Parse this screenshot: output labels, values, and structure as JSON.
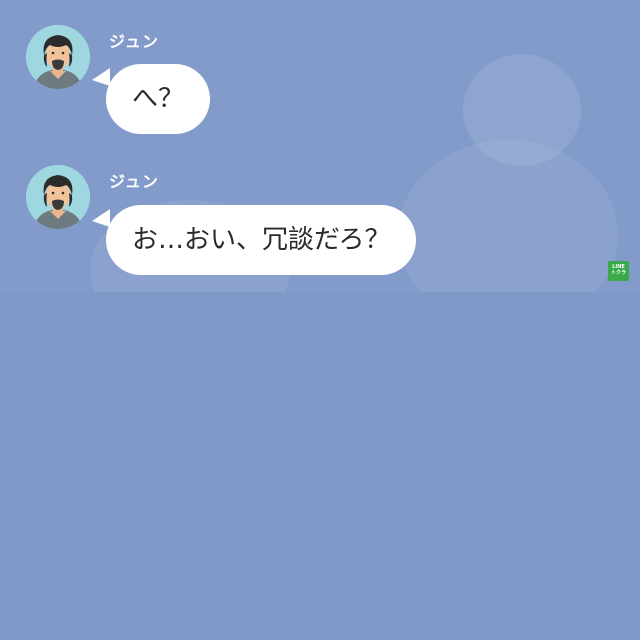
{
  "colors": {
    "chat_background": "#829bca",
    "lower_background": "#8099c8",
    "bubble": "#ffffff",
    "sender_name": "#ffffff",
    "watermark": "#3aa94a"
  },
  "messages": [
    {
      "sender": "ジュン",
      "avatar_icon": "user-avatar-icon",
      "text": "へ？"
    },
    {
      "sender": "ジュン",
      "avatar_icon": "user-avatar-icon",
      "text": "お…おい、冗談だろ？"
    }
  ],
  "watermark": {
    "line1": "LINE",
    "line2": "トクラ"
  }
}
